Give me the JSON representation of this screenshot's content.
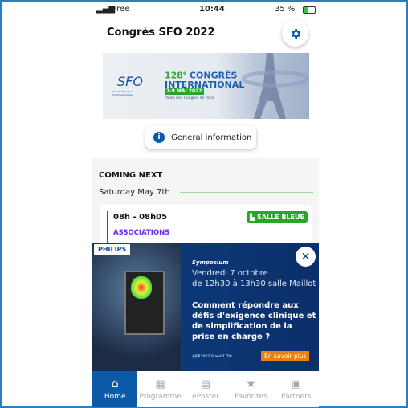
{
  "status": {
    "carrier": "Free",
    "time": "10:44",
    "battery": "35 %"
  },
  "header": {
    "title": "Congrès SFO 2022",
    "settings_icon": "gear-icon"
  },
  "banner": {
    "logo": "SFO",
    "logo_sub": "Société Française d'Ophtalmologie",
    "edition": "128",
    "edition_sup": "e",
    "line1": "CONGRÈS",
    "line2": "INTERNATIONAL",
    "dates": "7-9 MAI 2022",
    "venue": "Palais des Congrès de Paris"
  },
  "general_info": {
    "label": "General information",
    "icon": "info-icon"
  },
  "coming": {
    "heading": "COMING NEXT",
    "date": "Saturday May 7th",
    "event": {
      "time": "08h - 08h05",
      "room": "SALLE BLEUE",
      "category": "ASSOCIATIONS"
    }
  },
  "colors": {
    "accent": "#0b5aa8",
    "green": "#2aa52a",
    "purple": "#6a2cf5"
  },
  "ad": {
    "brand": "PHILIPS",
    "kicker": "Symposium",
    "line1": "Vendredi 7 octobre",
    "line2": "de 12h30 à 13h30 salle Maillot",
    "headline": "Comment répondre aux défis d'exigence clinique et de simplification de la prise en charge ?",
    "footer": "#JFR2022 Stand 1T08",
    "cta": "En savoir plus"
  },
  "nav": [
    {
      "label": "Home",
      "icon": "home-icon"
    },
    {
      "label": "Programme",
      "icon": "calendar-icon"
    },
    {
      "label": "ePoster",
      "icon": "poster-icon"
    },
    {
      "label": "Favorites",
      "icon": "star-icon"
    },
    {
      "label": "Partners",
      "icon": "shop-icon"
    }
  ]
}
